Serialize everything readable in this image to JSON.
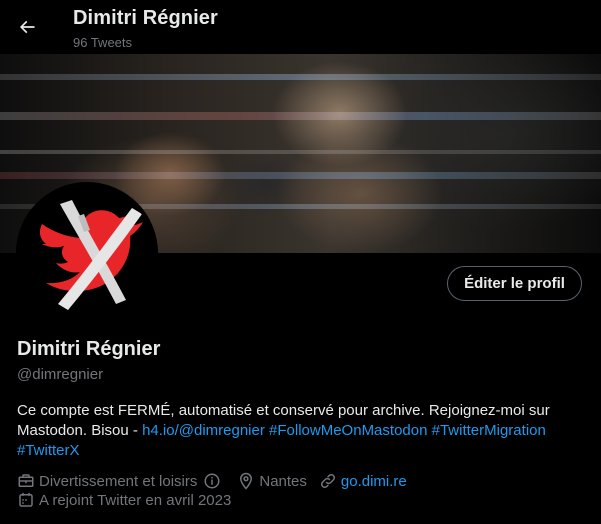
{
  "header": {
    "name": "Dimitri Régnier",
    "tweet_count": "96 Tweets",
    "back_icon": "arrow-left-icon"
  },
  "profile": {
    "name": "Dimitri Régnier",
    "handle": "@dimregnier",
    "edit_button": "Éditer le profil",
    "bio": {
      "text": "Ce compte est FERMÉ, automatisé et conservé pour archive. Rejoignez-moi sur Mastodon. Bisou - ",
      "links": [
        "h4.io/@dimregnier",
        "#FollowMeOnMastodon",
        "#TwitterMigration",
        "#TwitterX"
      ]
    },
    "category": "Divertissement et loisirs",
    "location": "Nantes",
    "website": "go.dimi.re",
    "joined": "A rejoint Twitter en avril 2023"
  },
  "colors": {
    "background": "#000000",
    "text_primary": "#e7e9ea",
    "text_secondary": "#71767b",
    "link": "#1d9bf0",
    "border": "#536471",
    "avatar_bird": "#e8262a"
  }
}
